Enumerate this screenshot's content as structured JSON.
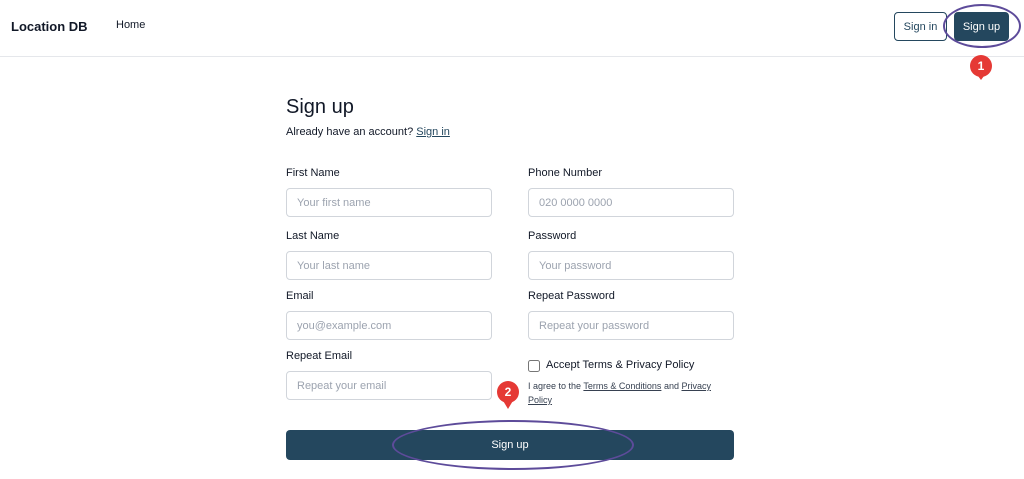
{
  "header": {
    "brand": "Location DB",
    "nav_home": "Home",
    "signin_label": "Sign in",
    "signup_label": "Sign up"
  },
  "form": {
    "title": "Sign up",
    "have_account_text": "Already have an account?",
    "have_account_link": "Sign in",
    "first_name": {
      "label": "First Name",
      "placeholder": "Your first name",
      "value": ""
    },
    "last_name": {
      "label": "Last Name",
      "placeholder": "Your last name",
      "value": ""
    },
    "email": {
      "label": "Email",
      "placeholder": "you@example.com",
      "value": ""
    },
    "repeat_email": {
      "label": "Repeat Email",
      "placeholder": "Repeat your email",
      "value": ""
    },
    "phone": {
      "label": "Phone Number",
      "placeholder": "020 0000 0000",
      "value": ""
    },
    "password": {
      "label": "Password",
      "placeholder": "Your password",
      "value": ""
    },
    "repeat_password": {
      "label": "Repeat Password",
      "placeholder": "Repeat your password",
      "value": ""
    },
    "terms": {
      "label": "Accept Terms & Privacy Policy",
      "desc_prefix": "I agree to the",
      "terms_link": "Terms & Conditions",
      "desc_and": "and",
      "privacy_link": "Privacy Policy",
      "checked": false
    },
    "submit_label": "Sign up"
  },
  "annotations": {
    "marker_1": "1",
    "marker_2": "2",
    "color_ellipse": "#5d4b9a",
    "color_marker": "#e53935"
  },
  "colors": {
    "primary": "#24475e"
  }
}
